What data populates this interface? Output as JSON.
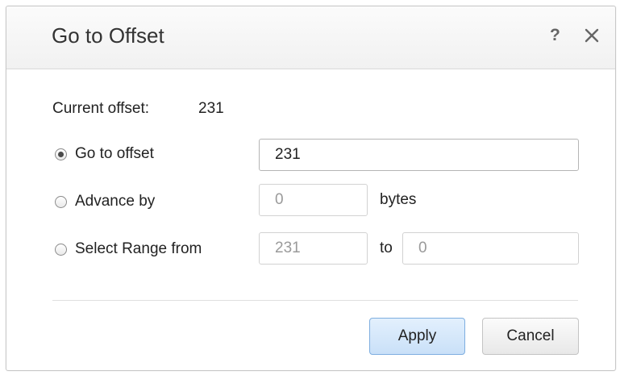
{
  "dialog": {
    "title": "Go to Offset",
    "help_glyph": "?",
    "close_icon": "close-icon"
  },
  "current_offset": {
    "label": "Current offset:",
    "value": "231"
  },
  "options": {
    "goto": {
      "label": "Go to offset",
      "selected": true,
      "value": "231"
    },
    "advance": {
      "label": "Advance by",
      "selected": false,
      "value": "0",
      "unit": "bytes"
    },
    "range": {
      "label": "Select Range from",
      "selected": false,
      "from_value": "231",
      "to_label": "to",
      "to_value": "0"
    }
  },
  "buttons": {
    "apply": "Apply",
    "cancel": "Cancel"
  },
  "colors": {
    "apply_border": "#7eaee0",
    "apply_fill": "#d6e8fb"
  }
}
